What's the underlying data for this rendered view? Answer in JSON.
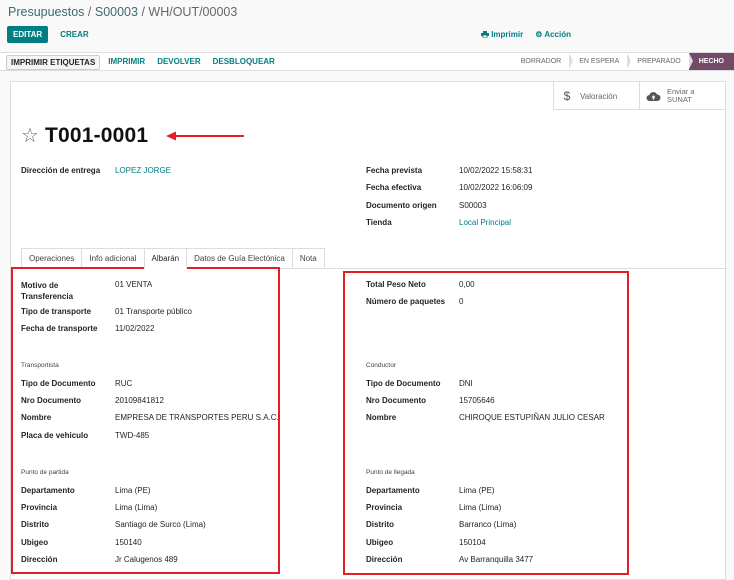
{
  "breadcrumb": {
    "part1": "Presupuestos",
    "sep1": " / ",
    "part2": "S00003",
    "sep2": " / ",
    "current": "WH/OUT/00003"
  },
  "control": {
    "edit_label": "EDITAR",
    "create_label": "CREAR",
    "print_label": "Imprimir",
    "action_label": "Acción"
  },
  "statusbar": {
    "buttons": [
      "IMPRIMIR ETIQUETAS",
      "IMPRIMIR",
      "DEVOLVER",
      "DESBLOQUEAR"
    ],
    "steps": [
      "BORRADOR",
      "EN ESPERA",
      "PREPARADO",
      "HECHO"
    ],
    "active_step": "HECHO"
  },
  "smart_buttons": {
    "valoracion": "Valoración",
    "sunat_line1": "Enviar a",
    "sunat_line2": "SUNAT"
  },
  "record": {
    "name": "T001-0001"
  },
  "header_fields": {
    "delivery_label": "Dirección de entrega",
    "delivery_value": "LOPEZ JORGE",
    "fecha_prevista_label": "Fecha prevista",
    "fecha_prevista_value": "10/02/2022 15:58:31",
    "fecha_efectiva_label": "Fecha efectiva",
    "fecha_efectiva_value": "10/02/2022 16:06:09",
    "doc_origen_label": "Documento origen",
    "doc_origen_value": "S00003",
    "tienda_label": "Tienda",
    "tienda_value": "Local Principal"
  },
  "tabs": [
    "Operaciones",
    "Info adicional",
    "Albarán",
    "Datos de Guía Electónica",
    "Nota"
  ],
  "active_tab": "Albarán",
  "left": {
    "motivo_label_1": "Motivo de",
    "motivo_label_2": "Transferencia",
    "motivo_value": "01 VENTA",
    "tipo_transporte_label": "Tipo de transporte",
    "tipo_transporte_value": "01 Transporte público",
    "fecha_transporte_label": "Fecha de transporte",
    "fecha_transporte_value": "11/02/2022",
    "transportista_title": "Transportista",
    "tipo_doc_label": "Tipo de Documento",
    "tipo_doc_value": "RUC",
    "nro_doc_label": "Nro Documento",
    "nro_doc_value": "20109841812",
    "nombre_label": "Nombre",
    "nombre_value": "EMPRESA DE TRANSPORTES PERU S.A.C.",
    "placa_label": "Placa de vehiculo",
    "placa_value": "TWD-485",
    "partida_title": "Punto de partida",
    "depto_label": "Departamento",
    "depto_value": "Lima (PE)",
    "prov_label": "Provincia",
    "prov_value": "Lima (Lima)",
    "dist_label": "Distrito",
    "dist_value": "Santiago de Surco (Lima)",
    "ubigeo_label": "Ubigeo",
    "ubigeo_value": "150140",
    "dir_label": "Dirección",
    "dir_value": "Jr Calugenos 489"
  },
  "right": {
    "peso_label": "Total Peso Neto",
    "peso_value": "0,00",
    "paquetes_label": "Número de paquetes",
    "paquetes_value": "0",
    "conductor_title": "Conductor",
    "tipo_doc_label": "Tipo de Documento",
    "tipo_doc_value": "DNI",
    "nro_doc_label": "Nro Documento",
    "nro_doc_value": "15705646",
    "nombre_label": "Nombre",
    "nombre_value": "CHIROQUE ESTUPIÑAN JULIO CESAR",
    "llegada_title": "Punto de llegada",
    "depto_label": "Departamento",
    "depto_value": "Lima (PE)",
    "prov_label": "Provincia",
    "prov_value": "Lima (Lima)",
    "dist_label": "Distrito",
    "dist_value": "Barranco (Lima)",
    "ubigeo_label": "Ubigeo",
    "ubigeo_value": "150104",
    "dir_label": "Dirección",
    "dir_value": "Av Barranquilla 3477"
  },
  "colors": {
    "primary": "#017e84",
    "active_step": "#714b67",
    "annotation": "#e41e26"
  },
  "icons": [
    "star-icon",
    "dollar-icon",
    "cloud-upload-icon",
    "print-icon",
    "gear-icon",
    "arrow-annotation-icon"
  ]
}
